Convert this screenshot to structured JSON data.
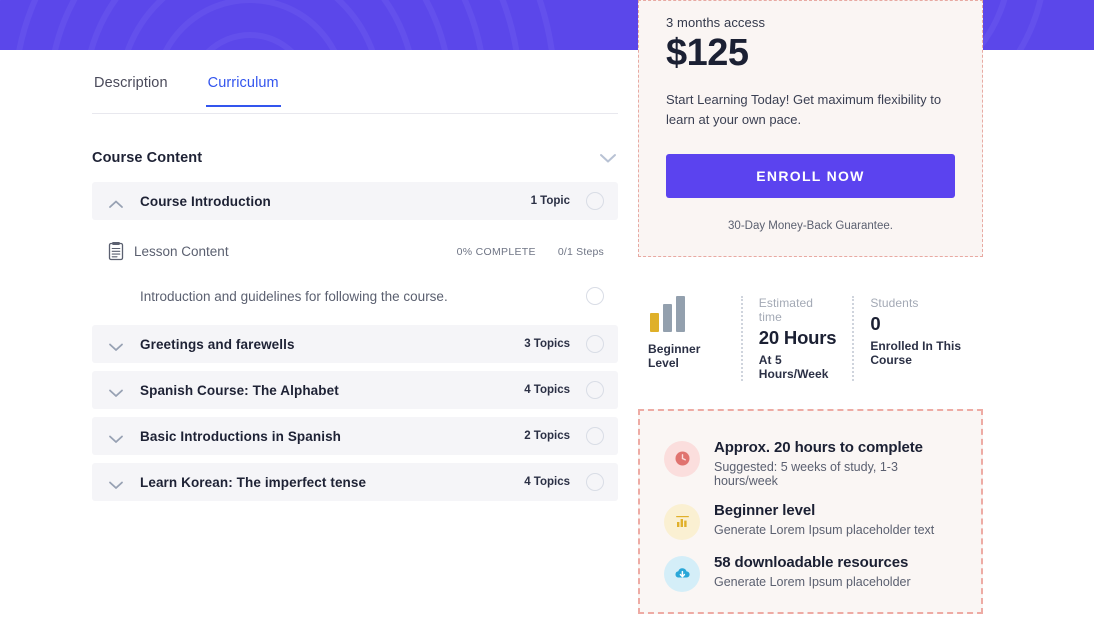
{
  "banner": {
    "color": "#5b47ea"
  },
  "tabs": [
    {
      "label": "Description",
      "active": false
    },
    {
      "label": "Curriculum",
      "active": true
    }
  ],
  "curriculum": {
    "heading": "Course Content",
    "toggle_icon": "chevron-down-icon",
    "sections": [
      {
        "title": "Course Introduction",
        "count": "1 Topic",
        "expanded": true,
        "icon": "chevron-up-icon"
      },
      {
        "title": "Greetings and farewells",
        "count": "3 Topics",
        "expanded": false,
        "icon": "chevron-down-icon"
      },
      {
        "title": "Spanish Course: The Alphabet",
        "count": "4 Topics",
        "expanded": false,
        "icon": "chevron-down-icon"
      },
      {
        "title": "Basic Introductions in Spanish",
        "count": "2 Topics",
        "expanded": false,
        "icon": "chevron-down-icon"
      },
      {
        "title": "Learn Korean: The imperfect tense",
        "count": "4 Topics",
        "expanded": false,
        "icon": "chevron-down-icon"
      }
    ],
    "lesson": {
      "name": "Lesson Content",
      "icon": "document-lines-icon",
      "percent_complete": "0% COMPLETE",
      "steps": "0/1 Steps"
    },
    "topic": {
      "text": "Introduction and guidelines for following the course."
    }
  },
  "pricing": {
    "term": "3 months access",
    "amount": "$125",
    "description": "Start Learning Today! Get maximum flexibility to learn at your own pace.",
    "cta": "ENROLL NOW",
    "guarantee": "30-Day Money-Back Guarantee.",
    "accent": "#5b43ef",
    "card_bg": "#faf5f3",
    "border": "#e8a9a2"
  },
  "stats": [
    {
      "label": "",
      "value": "",
      "sub": "Beginner Level",
      "icon": "bar-level-icon"
    },
    {
      "label": "Estimated time",
      "value": "20 Hours",
      "sub": "At 5 Hours/Week"
    },
    {
      "label": "Students",
      "value": "0",
      "sub": "Enrolled In This Course"
    }
  ],
  "features": [
    {
      "icon": "clock-icon",
      "icon_color": "#e0736f",
      "title": "Approx. 20 hours to complete",
      "subtitle": "Suggested: 5 weeks of study, 1-3 hours/week"
    },
    {
      "icon": "bar-chart-icon",
      "icon_color": "#e0b02a",
      "title": "Beginner level",
      "subtitle": "Generate Lorem Ipsum placeholder text"
    },
    {
      "icon": "cloud-download-icon",
      "icon_color": "#2aa7d8",
      "title": "58 downloadable resources",
      "subtitle": "Generate Lorem Ipsum placeholder"
    }
  ]
}
